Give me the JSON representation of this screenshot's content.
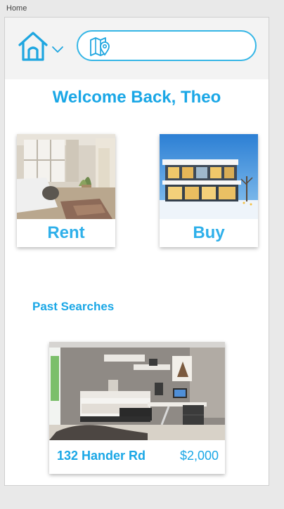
{
  "artboard": {
    "label": "Home"
  },
  "header": {
    "icons": {
      "home": "home-icon",
      "dropdown": "chevron-down-icon",
      "map": "map-pin-icon"
    },
    "search": {
      "value": "",
      "placeholder": ""
    }
  },
  "welcome": {
    "text": "Welcome Back, Theo"
  },
  "cards": [
    {
      "label": "Rent"
    },
    {
      "label": "Buy"
    }
  ],
  "past_searches": {
    "title": "Past Searches",
    "items": [
      {
        "address": "132 Hander Rd",
        "price": "$2,000"
      }
    ]
  },
  "colors": {
    "accent": "#1aa7e6",
    "search_border": "#35b6e6",
    "topbar_bg": "#f3f3f3",
    "page_bg": "#ffffff"
  }
}
